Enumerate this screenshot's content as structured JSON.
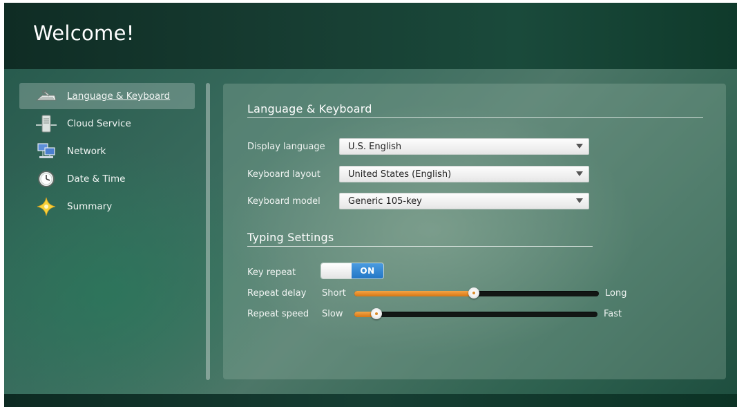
{
  "header": {
    "title": "Welcome!"
  },
  "sidebar": {
    "items": [
      {
        "label": "Language & Keyboard",
        "icon": "wrench-keyboard-icon",
        "active": true
      },
      {
        "label": "Cloud Service",
        "icon": "server-icon",
        "active": false
      },
      {
        "label": "Network",
        "icon": "network-icon",
        "active": false
      },
      {
        "label": "Date & Time",
        "icon": "clock-icon",
        "active": false
      },
      {
        "label": "Summary",
        "icon": "star-icon",
        "active": false
      }
    ]
  },
  "main": {
    "section_title": "Language & Keyboard",
    "display_language": {
      "label": "Display language",
      "value": "U.S. English"
    },
    "keyboard_layout": {
      "label": "Keyboard layout",
      "value": "United States (English)"
    },
    "keyboard_model": {
      "label": "Keyboard model",
      "value": "Generic 105-key"
    },
    "typing": {
      "title": "Typing Settings",
      "key_repeat": {
        "label": "Key repeat",
        "state": "ON"
      },
      "repeat_delay": {
        "label": "Repeat delay",
        "min_label": "Short",
        "max_label": "Long",
        "value_fraction": 0.49
      },
      "repeat_speed": {
        "label": "Repeat speed",
        "min_label": "Slow",
        "max_label": "Fast",
        "value_fraction": 0.09
      }
    }
  },
  "colors": {
    "accent_orange": "#e88b25",
    "toggle_blue": "#2f86d4"
  }
}
